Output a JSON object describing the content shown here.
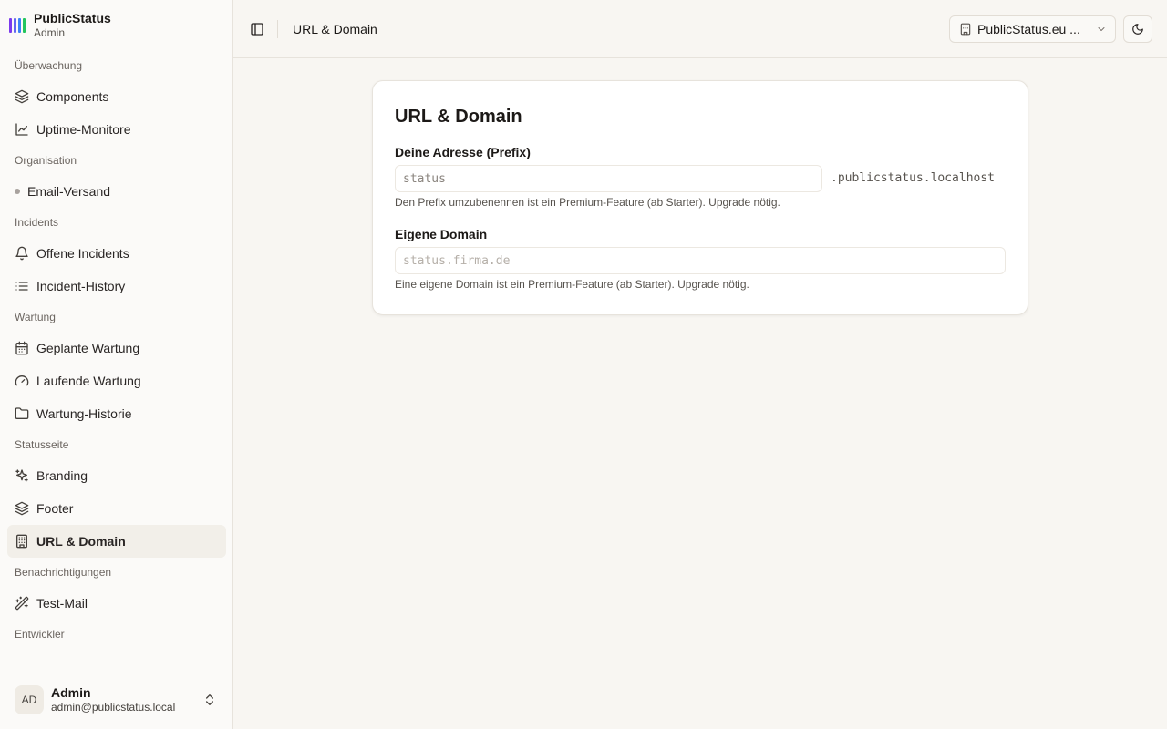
{
  "brand": {
    "name": "PublicStatus",
    "sub": "Admin",
    "logo_colors": [
      "#7c3aed",
      "#6366f1",
      "#3b82f6",
      "#22c55e"
    ]
  },
  "sidebar": {
    "groups": [
      {
        "label": "Überwachung",
        "items": [
          {
            "label": "Components",
            "icon": "layers-icon"
          },
          {
            "label": "Uptime-Monitore",
            "icon": "line-chart-icon"
          }
        ]
      },
      {
        "label": "Organisation",
        "items": [
          {
            "label": "Email-Versand",
            "icon": "dot-icon"
          }
        ]
      },
      {
        "label": "Incidents",
        "items": [
          {
            "label": "Offene Incidents",
            "icon": "bell-icon"
          },
          {
            "label": "Incident-History",
            "icon": "list-icon"
          }
        ]
      },
      {
        "label": "Wartung",
        "items": [
          {
            "label": "Geplante Wartung",
            "icon": "calendar-icon"
          },
          {
            "label": "Laufende Wartung",
            "icon": "gauge-icon"
          },
          {
            "label": "Wartung-Historie",
            "icon": "folder-icon"
          }
        ]
      },
      {
        "label": "Statusseite",
        "items": [
          {
            "label": "Branding",
            "icon": "sparkles-icon"
          },
          {
            "label": "Footer",
            "icon": "layers-icon"
          },
          {
            "label": "URL & Domain",
            "icon": "building-icon",
            "active": true
          }
        ]
      },
      {
        "label": "Benachrichtigungen",
        "items": [
          {
            "label": "Test-Mail",
            "icon": "wand-icon"
          }
        ]
      },
      {
        "label": "Entwickler",
        "items": []
      }
    ]
  },
  "user": {
    "initials": "AD",
    "name": "Admin",
    "email": "admin@publicstatus.local"
  },
  "header": {
    "title": "URL & Domain",
    "org_select": "PublicStatus.eu ..."
  },
  "card": {
    "title": "URL & Domain",
    "prefix": {
      "label": "Deine Adresse (Prefix)",
      "value": "status",
      "suffix": ".publicstatus.localhost",
      "help": "Den Prefix umzubenennen ist ein Premium-Feature (ab Starter). Upgrade nötig."
    },
    "domain": {
      "label": "Eigene Domain",
      "placeholder": "status.firma.de",
      "help": "Eine eigene Domain ist ein Premium-Feature (ab Starter). Upgrade nötig."
    }
  }
}
